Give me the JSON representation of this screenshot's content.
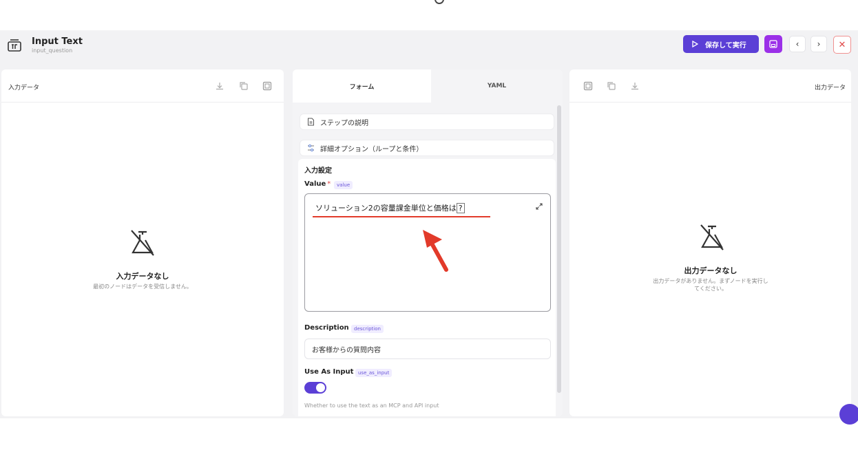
{
  "header": {
    "title": "Input Text",
    "subtitle": "input_question",
    "run_label": "保存して実行",
    "icons": {
      "node": "text-input-icon",
      "run": "play-icon",
      "save": "save-icon",
      "prev": "chevron-left-icon",
      "next": "chevron-right-icon",
      "close": "close-icon"
    }
  },
  "left_panel": {
    "label": "入力データ",
    "empty_title": "入力データなし",
    "empty_desc": "最初のノードはデータを受信しません。"
  },
  "middle_panel": {
    "tabs": [
      {
        "label": "フォーム",
        "active": true
      },
      {
        "label": "YAML",
        "active": false
      }
    ],
    "sections": [
      {
        "label": "ステップの説明",
        "icon": "document-icon"
      },
      {
        "label": "詳細オプション（ループと条件）",
        "icon": "sliders-icon"
      }
    ],
    "card_title": "入力設定",
    "value_field": {
      "label": "Value",
      "required_mark": "*",
      "key": "value",
      "text": "ソリューション2の容量課金単位と価格は",
      "cursor_char": "?"
    },
    "description_field": {
      "label": "Description",
      "key": "description",
      "value": "お客様からの質問内容"
    },
    "use_as_input_field": {
      "label": "Use As Input",
      "key": "use_as_input",
      "enabled": true,
      "help": "Whether to use the text as an MCP and API input"
    }
  },
  "right_panel": {
    "label": "出力データ",
    "empty_title": "出力データなし",
    "empty_desc_1": "出力データがありません。まずノードを実行し",
    "empty_desc_2": "てください。"
  },
  "colors": {
    "accent": "#5b3fd6",
    "save": "#9b30e8",
    "annotation_red": "#e23a2a",
    "close": "#e04848"
  }
}
